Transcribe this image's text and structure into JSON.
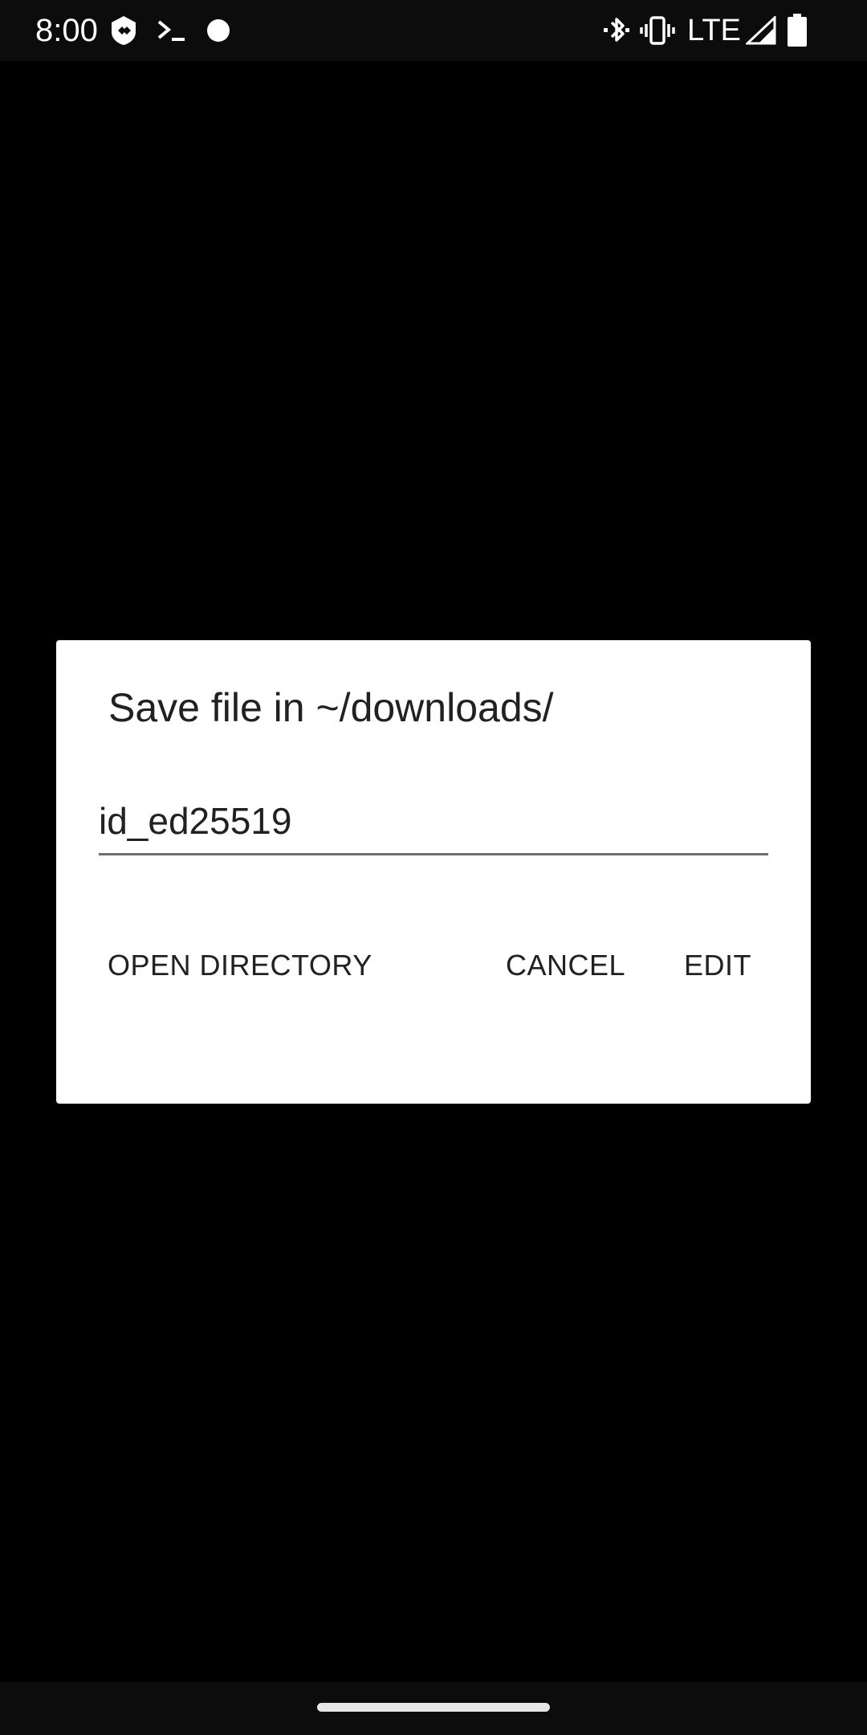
{
  "status_bar": {
    "time": "8:00",
    "network": "LTE",
    "icons": [
      "shield-notification-icon",
      "terminal-icon",
      "dot-icon",
      "bluetooth-icon",
      "vibrate-icon",
      "signal-icon",
      "battery-icon"
    ]
  },
  "dialog": {
    "title": "Save file in ~/downloads/",
    "filename_value": "id_ed25519",
    "open_directory_label": "OPEN DIRECTORY",
    "cancel_label": "CANCEL",
    "edit_label": "EDIT"
  },
  "colors": {
    "background": "#000000",
    "dialog_bg": "#ffffff",
    "text": "#212121",
    "underline": "#6f6f6f"
  }
}
